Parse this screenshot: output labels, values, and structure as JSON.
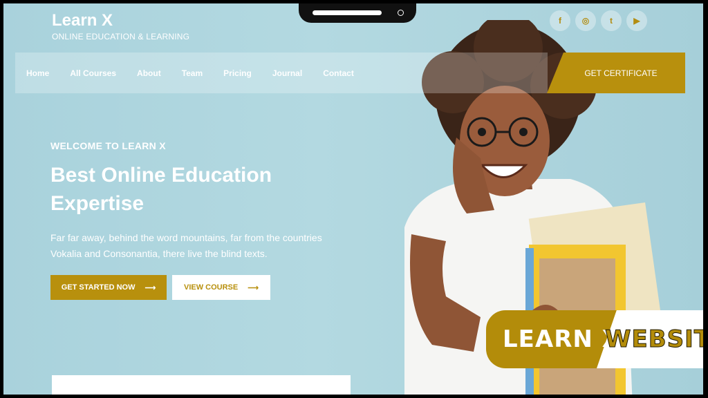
{
  "brand": {
    "title": "Learn X",
    "subtitle": "ONLINE EDUCATION & LEARNING"
  },
  "social": [
    {
      "icon": "facebook-icon",
      "glyph": "f"
    },
    {
      "icon": "instagram-icon",
      "glyph": "◎"
    },
    {
      "icon": "twitter-icon",
      "glyph": "t"
    },
    {
      "icon": "youtube-icon",
      "glyph": "▶"
    }
  ],
  "nav": {
    "items": [
      "Home",
      "All Courses",
      "About",
      "Team",
      "Pricing",
      "Journal",
      "Contact"
    ],
    "cta": "GET CERTIFICATE"
  },
  "hero": {
    "eyebrow": "WELCOME TO LEARN X",
    "headline_line1": "Best Online Education",
    "headline_line2": "Expertise",
    "description": "Far far away, behind the word mountains, far from the countries Vokalia and Consonantia, there live the blind texts.",
    "primary_button": "GET STARTED NOW",
    "secondary_button": "VIEW COURSE",
    "arrow": "⟶"
  },
  "badge": {
    "part1": "LEARN X",
    "part2": "WEBSITE"
  },
  "colors": {
    "accent": "#b8900d",
    "background": "#afd6df"
  }
}
